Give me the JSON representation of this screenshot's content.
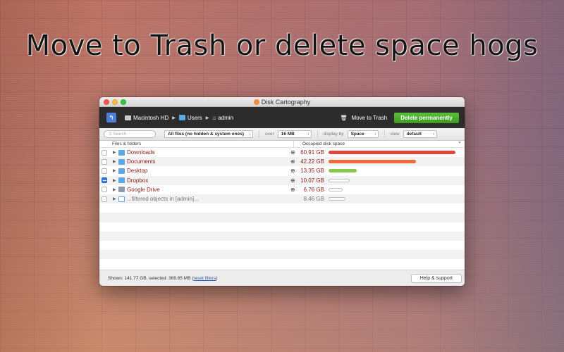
{
  "headline": "Move to Trash or delete space hogs",
  "window": {
    "title": "Disk Cartography",
    "breadcrumb": [
      "Macintosh HD",
      "Users",
      "admin"
    ],
    "move_to_trash_label": "Move to Trash",
    "delete_permanently_label": "Delete permanently"
  },
  "filters": {
    "search_placeholder": "Search",
    "file_filter": "All files (no hidden & system ones)",
    "over_label": "over",
    "over_value": "16 MB",
    "display_by_label": "display by",
    "display_by_value": "Space",
    "view_label": "view",
    "view_value": "default"
  },
  "columns": {
    "files": "Files & folders",
    "occupied": "Occupied disk space"
  },
  "rows": [
    {
      "name": "Downloads",
      "size": "60.91 GB",
      "fraction": 1.0,
      "color": "#e0473a",
      "checked": "none",
      "icon": "folder-icon"
    },
    {
      "name": "Documents",
      "size": "42.22 GB",
      "fraction": 0.69,
      "color": "#ef6a3a",
      "checked": "none",
      "icon": "folder-icon"
    },
    {
      "name": "Desktop",
      "size": "13.35 GB",
      "fraction": 0.22,
      "color": "#86c94a",
      "checked": "none",
      "icon": "folder-icon"
    },
    {
      "name": "Dropbox",
      "size": "10.07 GB",
      "fraction": 0.165,
      "color": "#ffffff",
      "checked": "mixed",
      "icon": "folder-icon"
    },
    {
      "name": "Google Drive",
      "size": "6.76 GB",
      "fraction": 0.11,
      "color": "#ffffff",
      "checked": "none",
      "icon": "drive-icon"
    },
    {
      "name": "...filtered objects in [admin]...",
      "size": "8.46 GB",
      "fraction": 0.135,
      "color": "#ffffff",
      "checked": "none",
      "icon": "filter-icon"
    }
  ],
  "status": {
    "shown_text": "Shown: 141.77 GB, selected: 369.85 MB (",
    "reset_link": "reset filters",
    "close_paren": ")",
    "help_label": "Help & support"
  },
  "colors": {
    "accent_green": "#4caf2c",
    "toolbar_bg": "#2c2c2c",
    "name_red": "#8b1a12"
  }
}
